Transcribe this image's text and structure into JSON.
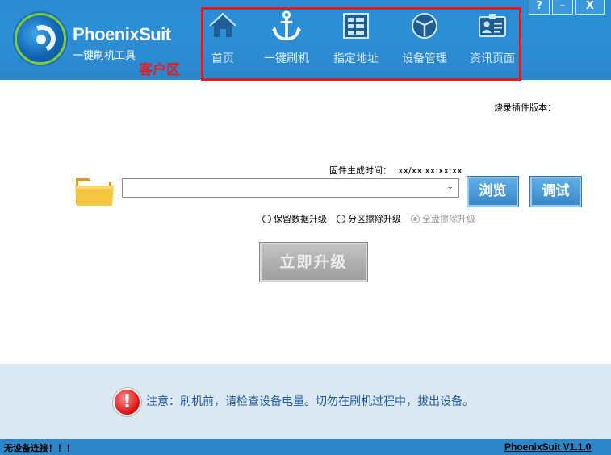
{
  "header": {
    "brand": "PhoenixSuit",
    "subtitle": "一键刷机工具",
    "client_label": "客户区",
    "nav": [
      {
        "label": "首页",
        "icon": "home-icon"
      },
      {
        "label": "一键刷机",
        "icon": "anchor-icon"
      },
      {
        "label": "指定地址",
        "icon": "grid-icon"
      },
      {
        "label": "设备管理",
        "icon": "cube-icon"
      },
      {
        "label": "资讯页面",
        "icon": "id-card-icon"
      }
    ],
    "window_buttons": {
      "help": "?",
      "minimize": "–",
      "close": "X"
    }
  },
  "main": {
    "plugin_version_label": "烧录插件版本：",
    "firmware_time_label": "固件生成时间：",
    "firmware_time_value": "xx/xx xx:xx:xx",
    "firmware_path_value": "",
    "browse_label": "浏览",
    "debug_label": "调试",
    "radios": [
      {
        "label": "保留数据升级",
        "enabled": true,
        "checked": false
      },
      {
        "label": "分区擦除升级",
        "enabled": true,
        "checked": false
      },
      {
        "label": "全盘擦除升级",
        "enabled": false,
        "checked": true
      }
    ],
    "upgrade_label": "立即升级"
  },
  "notice": {
    "icon": "alert-icon",
    "text": "注意：刷机前，请检查设备电量。切勿在刷机过程中，拔出设备。"
  },
  "status": {
    "left": "无设备连接！！！",
    "right": "PhoenixSuit V1.1.0"
  },
  "colors": {
    "header_bg": "#2b89d0",
    "highlight_border": "#e11b1b",
    "notice_bg": "#dce9f2",
    "status_bg": "#2d86c6"
  }
}
